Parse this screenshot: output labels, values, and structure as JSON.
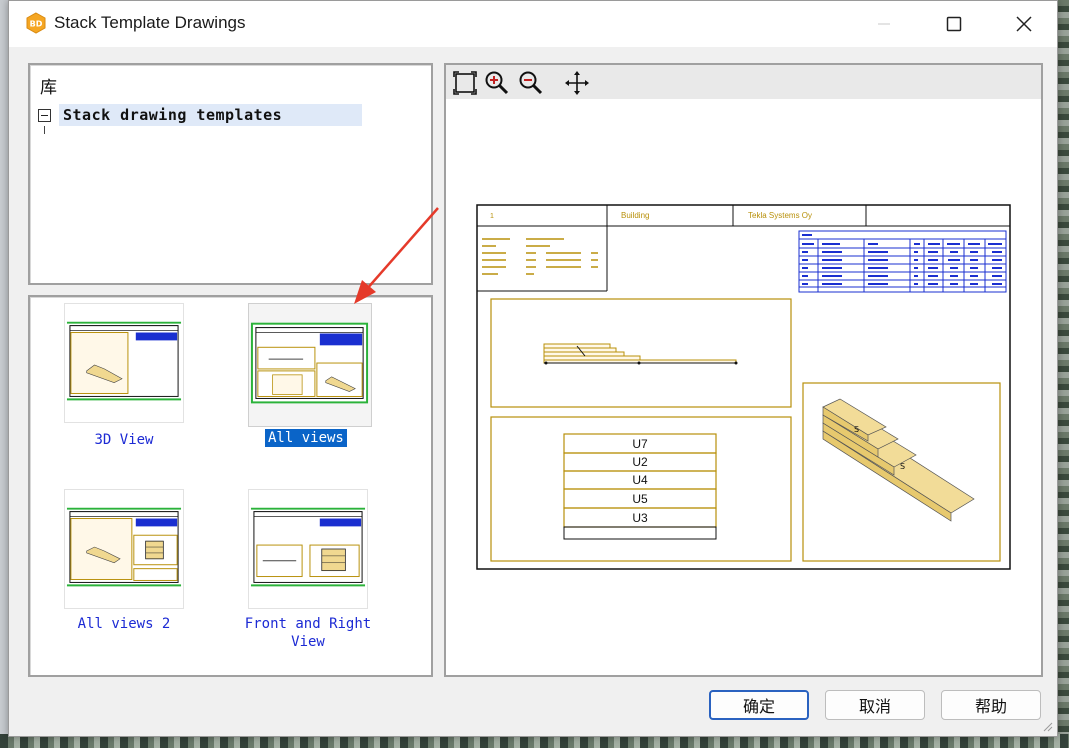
{
  "window": {
    "title": "Stack Template Drawings",
    "icon_text": "BD",
    "brand_color": "#f5a623"
  },
  "tree": {
    "header": "库",
    "root_label": "Stack drawing templates"
  },
  "templates": [
    {
      "label": "3D View",
      "selected": false
    },
    {
      "label": "All views",
      "selected": true
    },
    {
      "label": "All views 2",
      "selected": false
    },
    {
      "label": "Front and Right",
      "label2": "View",
      "selected": false
    }
  ],
  "preview": {
    "toolbar_icons": [
      "zoom-fit-icon",
      "zoom-in-icon",
      "zoom-out-icon",
      "pan-icon"
    ],
    "title_block": {
      "cell1": "1",
      "cell2": "Building",
      "cell3": "Tekla Systems Oy"
    },
    "stack_rows": [
      "U7",
      "U2",
      "U4",
      "U5",
      "U3"
    ]
  },
  "buttons": {
    "ok": "确定",
    "cancel": "取消",
    "help": "帮助"
  },
  "colors": {
    "selection": "#0a64c8",
    "template_label": "#1c2ad4",
    "drawing_frame": "#b8900a",
    "table_blue": "#1a2fd0",
    "annotation_arrow": "#e53a2a"
  }
}
